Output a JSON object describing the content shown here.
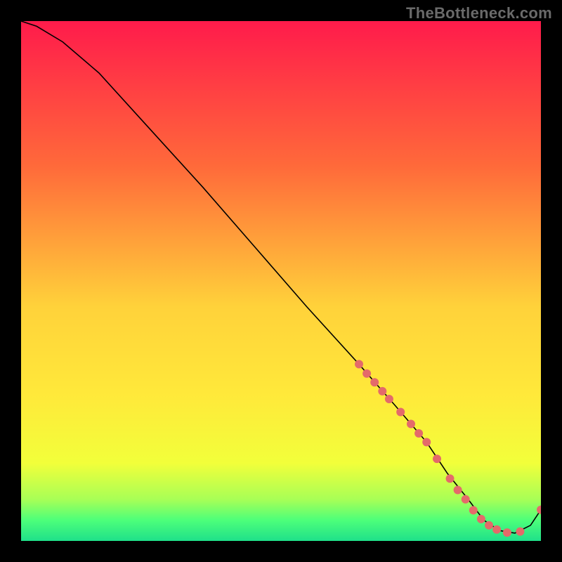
{
  "watermark": "TheBottleneck.com",
  "chart_data": {
    "type": "line",
    "title": "",
    "xlabel": "",
    "ylabel": "",
    "xlim": [
      0,
      100
    ],
    "ylim": [
      0,
      100
    ],
    "grid": false,
    "legend": false,
    "background": {
      "type": "vertical-gradient",
      "stops": [
        {
          "offset": 0.0,
          "color": "#ff1b4b"
        },
        {
          "offset": 0.28,
          "color": "#ff6a3a"
        },
        {
          "offset": 0.55,
          "color": "#ffd23a"
        },
        {
          "offset": 0.72,
          "color": "#ffe93a"
        },
        {
          "offset": 0.85,
          "color": "#f2ff3a"
        },
        {
          "offset": 0.92,
          "color": "#a8ff56"
        },
        {
          "offset": 0.96,
          "color": "#4dff7a"
        },
        {
          "offset": 1.0,
          "color": "#1fe08a"
        }
      ]
    },
    "series": [
      {
        "name": "bottleneck-curve",
        "color": "#000000",
        "x": [
          0,
          3,
          8,
          15,
          25,
          35,
          45,
          55,
          65,
          72,
          78,
          82,
          86,
          89,
          92,
          95,
          98,
          100
        ],
        "y": [
          100,
          99,
          96,
          90,
          79,
          68,
          56.5,
          45,
          34,
          26,
          19,
          13,
          8,
          4,
          2,
          1.5,
          3,
          6
        ]
      }
    ],
    "markers": {
      "name": "highlight-points",
      "color": "#e46a6a",
      "radius": 6,
      "points": [
        {
          "x": 65.0,
          "y": 34.0
        },
        {
          "x": 66.5,
          "y": 32.2
        },
        {
          "x": 68.0,
          "y": 30.5
        },
        {
          "x": 69.5,
          "y": 28.8
        },
        {
          "x": 70.8,
          "y": 27.3
        },
        {
          "x": 73.0,
          "y": 24.8
        },
        {
          "x": 75.0,
          "y": 22.5
        },
        {
          "x": 76.5,
          "y": 20.7
        },
        {
          "x": 78.0,
          "y": 19.0
        },
        {
          "x": 80.0,
          "y": 15.8
        },
        {
          "x": 82.5,
          "y": 12.0
        },
        {
          "x": 84.0,
          "y": 9.8
        },
        {
          "x": 85.5,
          "y": 8.0
        },
        {
          "x": 87.0,
          "y": 5.9
        },
        {
          "x": 88.5,
          "y": 4.2
        },
        {
          "x": 90.0,
          "y": 3.0
        },
        {
          "x": 91.5,
          "y": 2.2
        },
        {
          "x": 93.5,
          "y": 1.6
        },
        {
          "x": 96.0,
          "y": 1.8
        },
        {
          "x": 100.0,
          "y": 6.0
        }
      ]
    }
  }
}
